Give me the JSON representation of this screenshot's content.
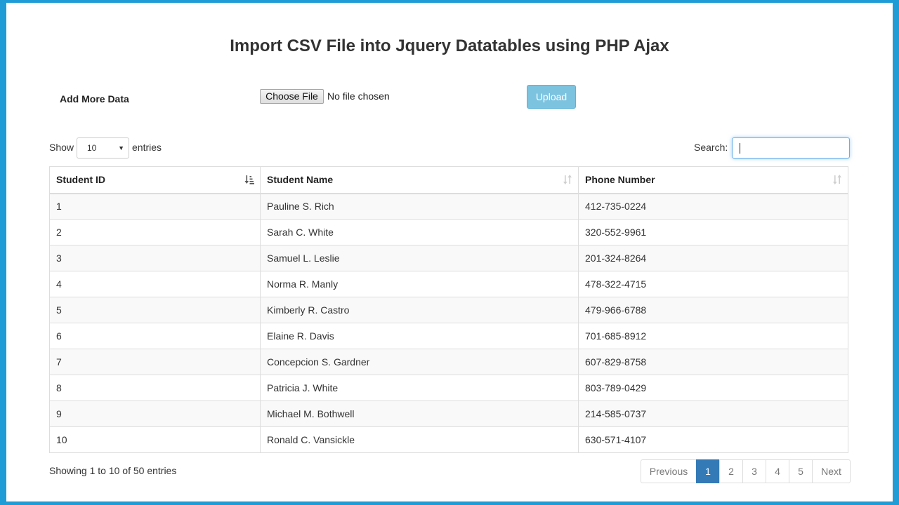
{
  "page": {
    "title": "Import CSV File into Jquery Datatables using PHP Ajax"
  },
  "upload_form": {
    "label": "Add More Data",
    "file_button_label": "Choose File",
    "file_status": "No file chosen",
    "upload_button_label": "Upload"
  },
  "length_menu": {
    "show_label": "Show",
    "selected_value": "10",
    "entries_label": "entries"
  },
  "search": {
    "label": "Search:",
    "value": ""
  },
  "table": {
    "columns": [
      "Student ID",
      "Student Name",
      "Phone Number"
    ],
    "rows": [
      [
        "1",
        "Pauline S. Rich",
        "412-735-0224"
      ],
      [
        "2",
        "Sarah C. White",
        "320-552-9961"
      ],
      [
        "3",
        "Samuel L. Leslie",
        "201-324-8264"
      ],
      [
        "4",
        "Norma R. Manly",
        "478-322-4715"
      ],
      [
        "5",
        "Kimberly R. Castro",
        "479-966-6788"
      ],
      [
        "6",
        "Elaine R. Davis",
        "701-685-8912"
      ],
      [
        "7",
        "Concepcion S. Gardner",
        "607-829-8758"
      ],
      [
        "8",
        "Patricia J. White",
        "803-789-0429"
      ],
      [
        "9",
        "Michael M. Bothwell",
        "214-585-0737"
      ],
      [
        "10",
        "Ronald C. Vansickle",
        "630-571-4107"
      ]
    ]
  },
  "info_text": "Showing 1 to 10 of 50 entries",
  "pagination": {
    "previous_label": "Previous",
    "pages": [
      "1",
      "2",
      "3",
      "4",
      "5"
    ],
    "active_page": "1",
    "next_label": "Next"
  },
  "colors": {
    "frame": "#1f9bd6",
    "upload_button": "#7cc3e0",
    "active_page": "#337ab7"
  }
}
